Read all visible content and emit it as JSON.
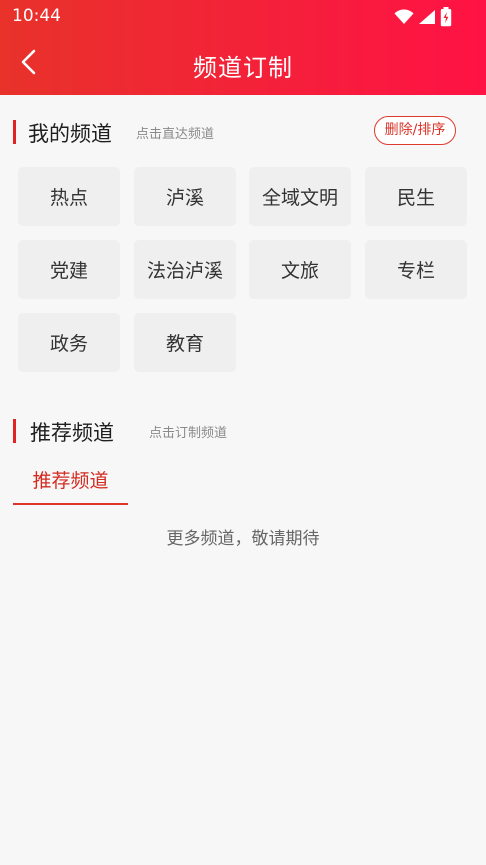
{
  "status_bar": {
    "time": "10:44",
    "icons": [
      "wifi-icon",
      "signal-icon",
      "battery-charging-icon"
    ]
  },
  "header": {
    "title": "频道订制",
    "back_icon": "chevron-left-icon",
    "gradient": [
      "#e8322a",
      "#ff1244"
    ]
  },
  "my_channels": {
    "title": "我的频道",
    "hint": "点击直达频道",
    "edit_label": "删除/排序",
    "items": [
      {
        "label": "热点"
      },
      {
        "label": "泸溪"
      },
      {
        "label": "全域文明"
      },
      {
        "label": "民生"
      },
      {
        "label": "党建"
      },
      {
        "label": "法治泸溪"
      },
      {
        "label": "文旅"
      },
      {
        "label": "专栏"
      },
      {
        "label": "政务"
      },
      {
        "label": "教育"
      }
    ]
  },
  "recommended": {
    "title": "推荐频道",
    "hint": "点击订制频道",
    "tab_label": "推荐频道",
    "empty_message": "更多频道，敬请期待"
  },
  "colors": {
    "accent": "#e02424",
    "chip_bg": "#efefef",
    "page_bg": "#f7f7f7"
  }
}
